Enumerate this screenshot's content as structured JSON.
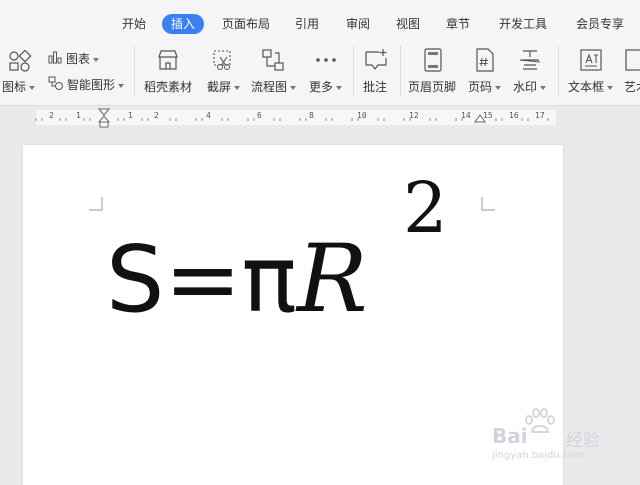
{
  "menu": {
    "tabs": [
      "开始",
      "插入",
      "页面布局",
      "引用",
      "审阅",
      "视图",
      "章节",
      "开发工具",
      "会员专享"
    ],
    "active_index": 1
  },
  "ribbon": {
    "icon_label": "图标",
    "chart_label": "图表",
    "smart_art_label": "智能图形",
    "docer_label": "稻壳素材",
    "screenshot_label": "截屏",
    "flowchart_label": "流程图",
    "more_label": "更多",
    "comment_label": "批注",
    "header_footer_label": "页眉页脚",
    "page_number_label": "页码",
    "watermark_label": "水印",
    "textbox_label": "文本框",
    "art_label": "艺术"
  },
  "ruler": {
    "numbers": [
      "2",
      "1",
      "1",
      "2",
      "4",
      "6",
      "8",
      "10",
      "12",
      "14",
      "15",
      "16",
      "17"
    ]
  },
  "document": {
    "formula_main": "S=π",
    "formula_var": "R",
    "formula_exp": "2"
  },
  "watermark": {
    "brand": "Bai",
    "brand_cn": "经验",
    "url": "jingyan.baidu.com"
  },
  "colors": {
    "accent": "#3c7ff0",
    "ribbon_bg": "#f4f5f7",
    "workspace_bg": "#e9eaec"
  }
}
